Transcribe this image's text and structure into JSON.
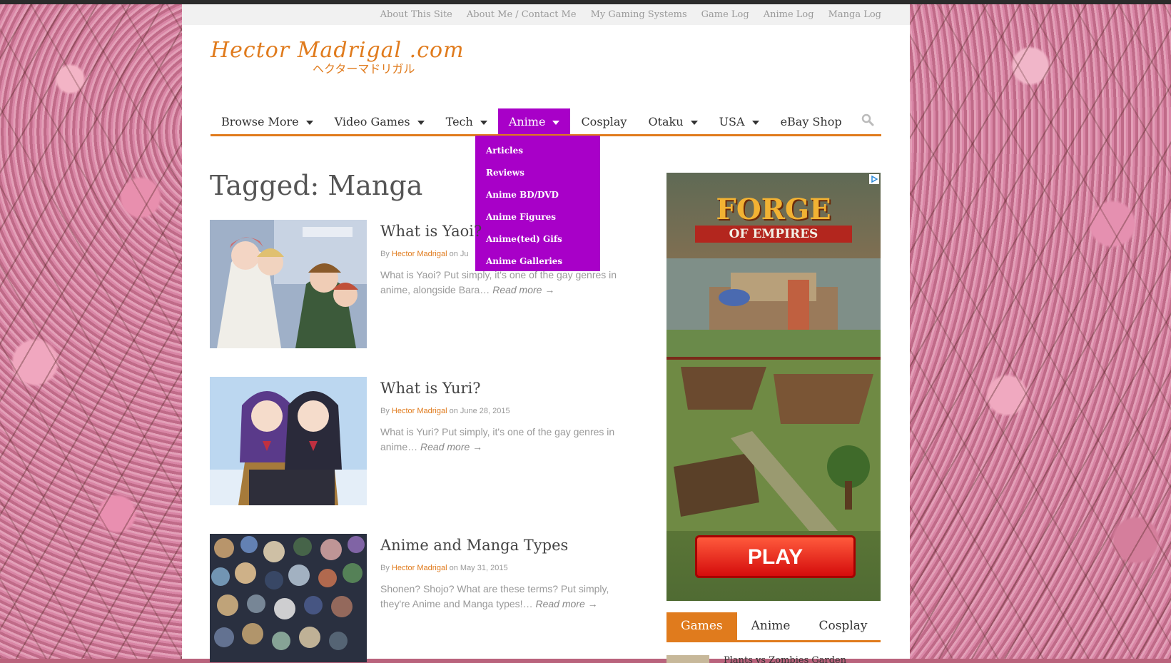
{
  "topbar": {
    "links": [
      "About This Site",
      "About Me / Contact Me",
      "My Gaming Systems",
      "Game Log",
      "Anime Log",
      "Manga Log"
    ]
  },
  "logo": {
    "title": "Hector Madrigal .com",
    "subtitle": "ヘクターマドリガル"
  },
  "nav": {
    "items": [
      {
        "label": "Browse More",
        "caret": true
      },
      {
        "label": "Video Games",
        "caret": true
      },
      {
        "label": "Tech",
        "caret": true
      },
      {
        "label": "Anime",
        "caret": true,
        "active": true
      },
      {
        "label": "Cosplay",
        "caret": false
      },
      {
        "label": "Otaku",
        "caret": true
      },
      {
        "label": "USA",
        "caret": true
      },
      {
        "label": "eBay Shop",
        "caret": false
      }
    ],
    "active_color": "#a800c8",
    "accent_color": "#e07b1d",
    "search_icon": "search-icon"
  },
  "dropdown": {
    "items": [
      "Articles",
      "Reviews",
      "Anime BD/DVD",
      "Anime Figures",
      "Anime(ted) Gifs",
      "Anime Galleries"
    ]
  },
  "page": {
    "title": "Tagged: Manga"
  },
  "posts": [
    {
      "title": "What is Yaoi?",
      "by": "By",
      "author": "Hector Madrigal",
      "date": "on Ju",
      "excerpt": "What is Yaoi? Put simply, it's one of the gay genres in anime, alongside Bara… ",
      "read_more": "Read more →"
    },
    {
      "title": "What is Yuri?",
      "by": "By",
      "author": "Hector Madrigal",
      "date": "on June 28, 2015",
      "excerpt": "What is Yuri? Put simply, it's one of the gay genres in anime… ",
      "read_more": "Read more →"
    },
    {
      "title": "Anime and Manga Types",
      "by": "By",
      "author": "Hector Madrigal",
      "date": "on May 31, 2015",
      "excerpt": "Shonen? Shojo? What are these terms? Put simply, they're Anime and Manga types!… ",
      "read_more": "Read more →"
    }
  ],
  "ad": {
    "brand_line1": "FORGE",
    "brand_line2": "OF EMPIRES",
    "button": "PLAY"
  },
  "sidebar_tabs": {
    "items": [
      "Games",
      "Anime",
      "Cosplay"
    ],
    "active": 0
  },
  "widget": {
    "first_item": "Plants vs Zombies Garden"
  }
}
